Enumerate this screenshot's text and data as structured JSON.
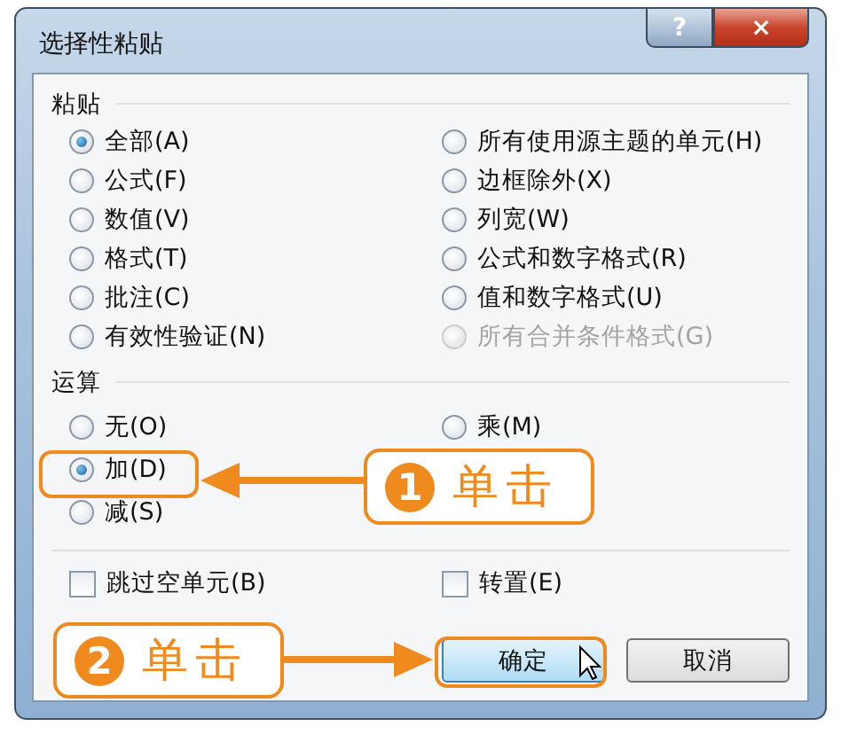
{
  "window": {
    "title": "选择性粘贴",
    "help_button": "?",
    "close_button": "×"
  },
  "paste": {
    "label": "粘贴",
    "columns": [
      [
        {
          "label": "全部(A)",
          "selected": true,
          "disabled": false
        },
        {
          "label": "公式(F)",
          "selected": false,
          "disabled": false
        },
        {
          "label": "数值(V)",
          "selected": false,
          "disabled": false
        },
        {
          "label": "格式(T)",
          "selected": false,
          "disabled": false
        },
        {
          "label": "批注(C)",
          "selected": false,
          "disabled": false
        },
        {
          "label": "有效性验证(N)",
          "selected": false,
          "disabled": false
        }
      ],
      [
        {
          "label": "所有使用源主题的单元(H)",
          "selected": false,
          "disabled": false
        },
        {
          "label": "边框除外(X)",
          "selected": false,
          "disabled": false
        },
        {
          "label": "列宽(W)",
          "selected": false,
          "disabled": false
        },
        {
          "label": "公式和数字格式(R)",
          "selected": false,
          "disabled": false
        },
        {
          "label": "值和数字格式(U)",
          "selected": false,
          "disabled": false
        },
        {
          "label": "所有合并条件格式(G)",
          "selected": false,
          "disabled": true
        }
      ]
    ]
  },
  "operation": {
    "label": "运算",
    "columns": [
      [
        {
          "label": "无(O)",
          "selected": false,
          "disabled": false
        },
        {
          "label": "加(D)",
          "selected": true,
          "disabled": false
        },
        {
          "label": "减(S)",
          "selected": false,
          "disabled": false
        }
      ],
      [
        {
          "label": "乘(M)",
          "selected": false,
          "disabled": false
        }
      ]
    ]
  },
  "checkboxes": [
    {
      "label": "跳过空单元(B)",
      "checked": false
    },
    {
      "label": "转置(E)",
      "checked": false
    }
  ],
  "buttons": [
    {
      "label": "确定",
      "default": true
    },
    {
      "label": "取消",
      "default": false
    }
  ],
  "callouts": [
    {
      "number": "1",
      "text": "单击"
    },
    {
      "number": "2",
      "text": "单击"
    }
  ]
}
